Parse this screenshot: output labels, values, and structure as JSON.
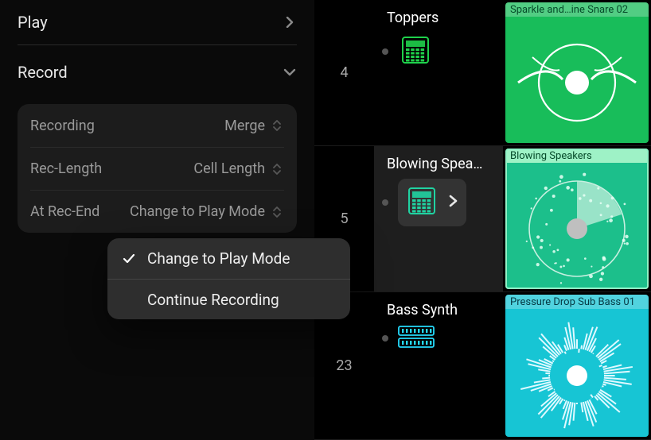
{
  "menu": {
    "play": "Play",
    "record": "Record"
  },
  "settings": {
    "recording_label": "Recording",
    "recording_value": "Merge",
    "reclength_label": "Rec-Length",
    "reclength_value": "Cell Length",
    "atrecend_label": "At Rec-End",
    "atrecend_value": "Change to Play Mode"
  },
  "popover": {
    "opt1": "Change to Play Mode",
    "opt2": "Continue Recording",
    "selected": 0
  },
  "tracks": [
    {
      "index": "4",
      "name": "Toppers",
      "instrument": "drum-machine",
      "instrument_color": "#1fd14b",
      "clip_label": "Sparkle and…ine Snare 02",
      "clip_color": "#18bd5a",
      "height": 184,
      "active": false
    },
    {
      "index": "5",
      "name": "Blowing Spea…",
      "instrument": "drum-machine",
      "instrument_color": "#20d3a2",
      "clip_label": "Blowing Speakers",
      "clip_color": "#1cbf8b",
      "height": 184,
      "active": true
    },
    {
      "index": "23",
      "name": "Bass Synth",
      "instrument": "synth-rack",
      "instrument_color": "#24dafc",
      "clip_label": "Pressure Drop Sub Bass 01",
      "clip_color": "#17c5d4",
      "height": 186,
      "active": false
    }
  ]
}
